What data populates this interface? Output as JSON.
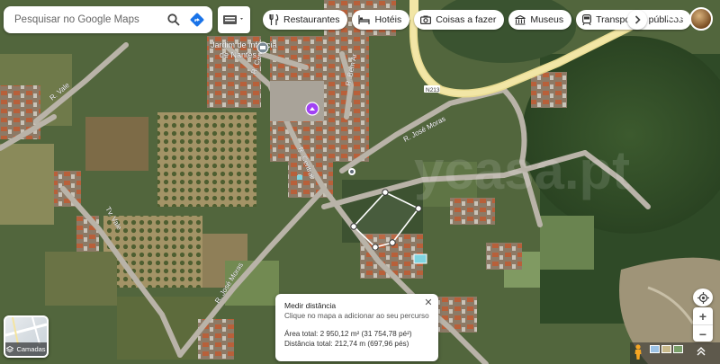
{
  "search": {
    "placeholder": "Pesquisar no Google Maps",
    "search_icon": "search-icon",
    "directions_icon": "directions-icon"
  },
  "chips": [
    {
      "label": "Restaurantes",
      "icon": "restaurant-icon"
    },
    {
      "label": "Hotéis",
      "icon": "hotel-icon"
    },
    {
      "label": "Coisas a fazer",
      "icon": "camera-icon"
    },
    {
      "label": "Museus",
      "icon": "museum-icon"
    },
    {
      "label": "Transportes públicos",
      "icon": "transit-icon"
    }
  ],
  "map_labels": {
    "school_line1": "Jardim de Infância",
    "school_line2": "de Nantes",
    "road_vale_top": "R. Vale",
    "road_central_1": "R. Central",
    "road_central_2": "R. Central",
    "road_bem_ar": "R. Bem Ar",
    "road_jose_moras_top": "R. José Moras",
    "road_jose_moras_bottom": "R. José Moras",
    "road_tv_vale": "Tv. Vale",
    "road_n213": "N213",
    "watermark": "ycasa.pt"
  },
  "measure": {
    "title": "Medir distância",
    "hint": "Clique no mapa a adicionar ao seu percurso",
    "area": "Área total: 2 950,12 m² (31 754,78 pé²)",
    "distance": "Distância total: 212,74 m (697,96 pés)"
  },
  "layers": {
    "label": "Camadas"
  },
  "colors": {
    "measure_line": "#ffffff",
    "purple_pin": "#a142f4",
    "road_yellow": "#f2e6a6"
  }
}
